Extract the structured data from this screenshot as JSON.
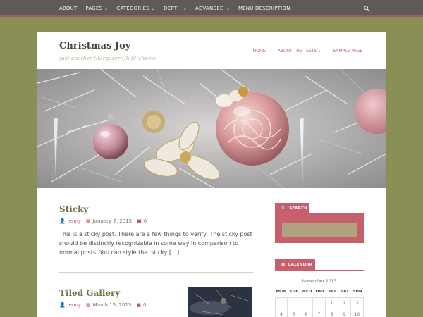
{
  "topnav": {
    "items": [
      {
        "label": "ABOUT",
        "caret": ""
      },
      {
        "label": "PAGES",
        "caret": "⌄"
      },
      {
        "label": "CATEGORIES",
        "caret": "⌄"
      },
      {
        "label": "DEPTH",
        "caret": "⌄"
      },
      {
        "label": "ADVANCED",
        "caret": "⌄"
      },
      {
        "label": "MENU DESCRIPTION",
        "caret": ""
      }
    ]
  },
  "site": {
    "title": "Christmas Joy",
    "description": "Just another Stargazer Child Theme"
  },
  "mainnav": {
    "items": [
      {
        "label": "HOME",
        "caret": ""
      },
      {
        "label": "ABOUT THE TESTS",
        "caret": "⌄"
      },
      {
        "label": "SAMPLE PAGE",
        "caret": ""
      }
    ]
  },
  "posts": [
    {
      "title": "Sticky",
      "author": "jenny",
      "date": "January 7, 2013",
      "comments": "0",
      "excerpt": "This is a sticky post. There are a few things to verify: The sticky post should be distinctly recognizable in some way in comparison to normal posts. You can style the .sticky […]"
    },
    {
      "title": "Tiled Gallery",
      "author": "jenny",
      "date": "March 15, 2013",
      "comments": "0"
    }
  ],
  "sidebar": {
    "search_title": "SEARCH",
    "calendar_title": "CALENDAR",
    "calendar_caption": "November 2013",
    "weekdays": [
      "MON",
      "TUE",
      "WED",
      "THU",
      "FRI",
      "SAT",
      "SUN"
    ],
    "week_rows": [
      [
        "",
        "",
        "",
        "",
        "1",
        "2",
        "3"
      ],
      [
        "4",
        "5",
        "6",
        "7",
        "8",
        "9",
        "10"
      ]
    ]
  },
  "colors": {
    "accent": "#c85f6d",
    "olive": "#8a8f55",
    "topbar": "#5e5a56"
  },
  "icons": {
    "search": "search-icon",
    "user": "user-icon",
    "calendar": "calendar-icon",
    "comment": "comment-icon"
  }
}
